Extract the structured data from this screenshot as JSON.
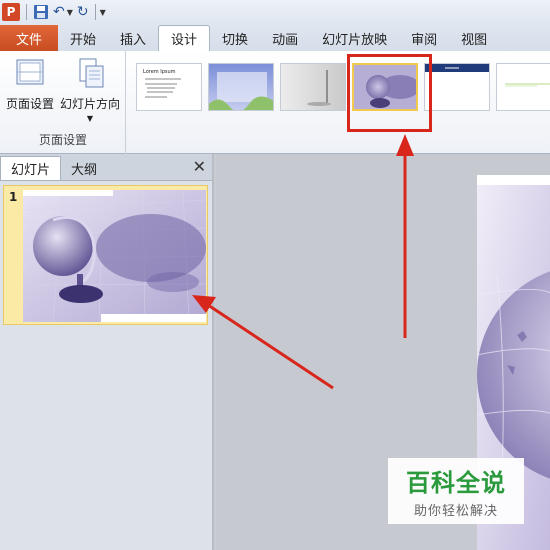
{
  "quick_access": {
    "app_icon_letter": "P",
    "icons": [
      "powerpoint-icon",
      "save-icon",
      "undo-icon",
      "redo-icon",
      "customize-icon"
    ]
  },
  "tabs": {
    "file": "文件",
    "items": [
      "开始",
      "插入",
      "设计",
      "切换",
      "动画",
      "幻灯片放映",
      "审阅",
      "视图"
    ],
    "active": "设计"
  },
  "ribbon": {
    "page_setup_label": "页面设置",
    "orientation_label": "幻灯片方向",
    "group_label": "页面设置",
    "theme_title_text": "Lorem Ipsum"
  },
  "pane": {
    "tab_slides": "幻灯片",
    "tab_outline": "大纲",
    "close": "✕",
    "slide_number": "1"
  },
  "watermark": {
    "title": "百科全说",
    "subtitle": "助你轻松解决"
  },
  "colors": {
    "accent_red": "#d9261c",
    "file_tab": "#d0562a",
    "highlight": "#fbe9a6",
    "watermark_green": "#2a9a3c"
  }
}
